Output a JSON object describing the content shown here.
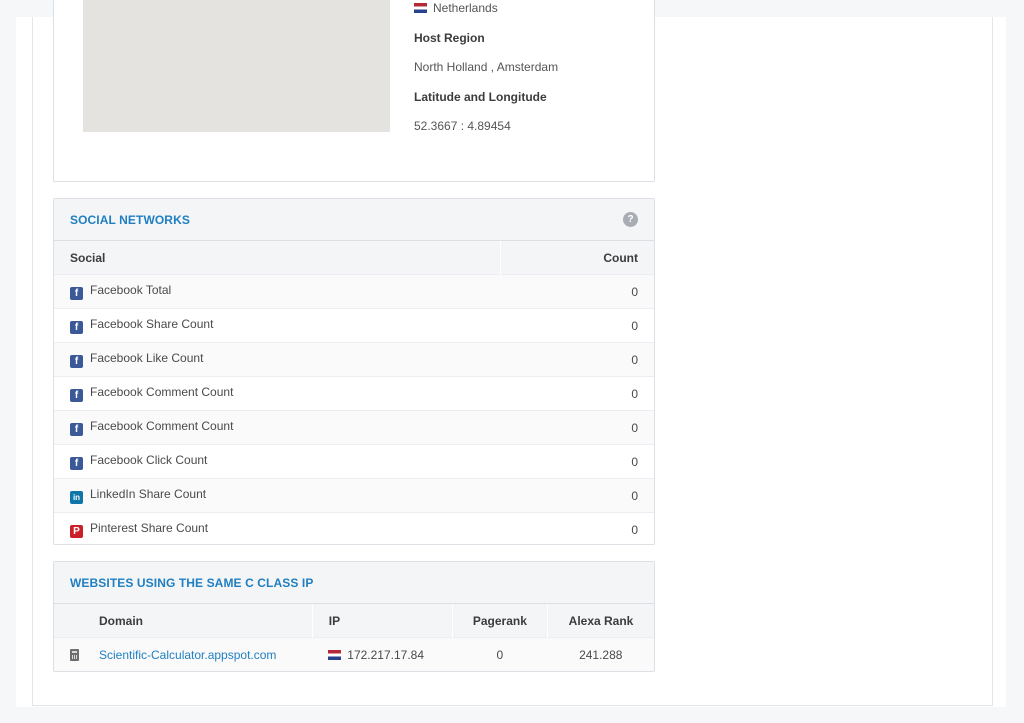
{
  "location": {
    "country": "Netherlands",
    "host_region_label": "Host Region",
    "host_region_value": "North Holland , Amsterdam",
    "latlng_label": "Latitude and Longitude",
    "latlng_value": "52.3667 : 4.89454"
  },
  "social": {
    "title": "SOCIAL NETWORKS",
    "help": "?",
    "headers": {
      "social": "Social",
      "count": "Count"
    },
    "rows": [
      {
        "icon": "facebook-icon",
        "label": "Facebook Total",
        "count": "0"
      },
      {
        "icon": "facebook-icon",
        "label": "Facebook Share Count",
        "count": "0"
      },
      {
        "icon": "facebook-icon",
        "label": "Facebook Like Count",
        "count": "0"
      },
      {
        "icon": "facebook-icon",
        "label": "Facebook Comment Count",
        "count": "0"
      },
      {
        "icon": "facebook-icon",
        "label": "Facebook Comment Count",
        "count": "0"
      },
      {
        "icon": "facebook-icon",
        "label": "Facebook Click Count",
        "count": "0"
      },
      {
        "icon": "linkedin-icon",
        "label": "LinkedIn Share Count",
        "count": "0"
      },
      {
        "icon": "pinterest-icon",
        "label": "Pinterest Share Count",
        "count": "0"
      }
    ]
  },
  "same_ip": {
    "title": "WEBSITES USING THE SAME C CLASS IP",
    "headers": {
      "domain": "Domain",
      "ip": "IP",
      "pagerank": "Pagerank",
      "alexa": "Alexa Rank"
    },
    "rows": [
      {
        "domain": "Scientific-Calculator.appspot.com",
        "ip": "172.217.17.84",
        "pagerank": "0",
        "alexa": "241.288"
      }
    ]
  },
  "colors": {
    "accent": "#1f7fc1",
    "facebook": "#3b5998",
    "linkedin": "#0e76a8",
    "pinterest": "#cb2027"
  }
}
